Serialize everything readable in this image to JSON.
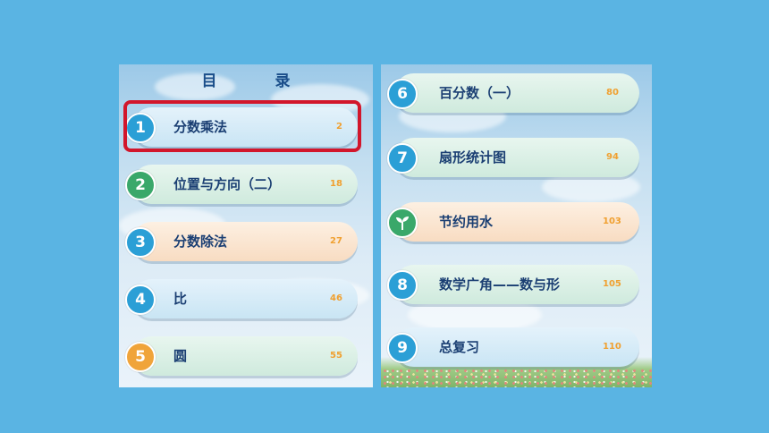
{
  "toc": {
    "title": "目　录",
    "left_items": [
      {
        "num": "1",
        "label": "分数乘法",
        "page": "2"
      },
      {
        "num": "2",
        "label": "位置与方向（二）",
        "page": "18"
      },
      {
        "num": "3",
        "label": "分数除法",
        "page": "27"
      },
      {
        "num": "4",
        "label": "比",
        "page": "46"
      },
      {
        "num": "5",
        "label": "圆",
        "page": "55"
      }
    ],
    "right_items": [
      {
        "num": "6",
        "label": "百分数（一）",
        "page": "80"
      },
      {
        "num": "7",
        "label": "扇形统计图",
        "page": "94"
      },
      {
        "icon": "sprout-icon",
        "label": "节约用水",
        "page": "103"
      },
      {
        "num": "8",
        "label": "数学广角——数与形",
        "page": "105"
      },
      {
        "num": "9",
        "label": "总复习",
        "page": "110"
      }
    ]
  },
  "colors": {
    "background": "#5ab4e3",
    "highlight": "#d2162b",
    "page_number": "#f0a030",
    "label": "#1b3f73"
  },
  "highlighted_item": "分数乘法"
}
